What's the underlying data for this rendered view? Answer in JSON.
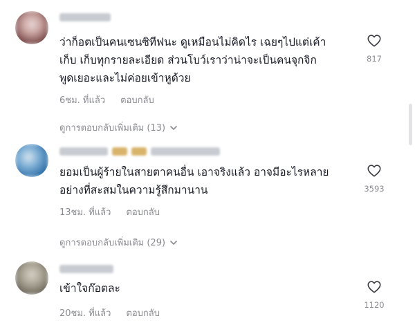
{
  "comments": [
    {
      "text_lines": [
        "ว่าก็อตเป็นคนเซนซิทีฟนะ ดูเหมือนไม่คิดไร เฉยๆไปแต่เค้า",
        "เก็บ เก็บทุกรายละเอียด ส่วนโบว์เราว่าน่าจะเป็นคนจุกจิก",
        "พูดเยอะและไม่ค่อยเข้าหูด้วย"
      ],
      "time": "6ชม. ที่แล้ว",
      "reply_label": "ตอบกลับ",
      "likes": "817",
      "more_replies": "ดูการตอบกลับเพิ่มเติม (13)",
      "avatar_colors": [
        "#7a4b4b",
        "#c9a3a0",
        "#e8d8d6"
      ]
    },
    {
      "text_lines": [
        "ยอมเป็นผู้ร้ายในสายตาคนอื่น เอาจริงแล้ว อาจมีอะไรหลาย",
        "อย่างที่สะสมในความรู้สึกมานาน"
      ],
      "time": "13ชม. ที่แล้ว",
      "reply_label": "ตอบกลับ",
      "likes": "3593",
      "more_replies": "ดูการตอบกลับเพิ่มเติม (29)",
      "avatar_colors": [
        "#2f6fa8",
        "#7fb0d6",
        "#d6e4ee"
      ]
    },
    {
      "text_lines": [
        "เข้าใจก๊อตละ"
      ],
      "time": "20ชม. ที่แล้ว",
      "reply_label": "ตอบกลับ",
      "likes": "1120",
      "avatar_colors": [
        "#6b6559",
        "#a8a293",
        "#d7d2c6"
      ]
    }
  ],
  "colors": {
    "text": "#161823",
    "secondary": "#8a8b91"
  }
}
